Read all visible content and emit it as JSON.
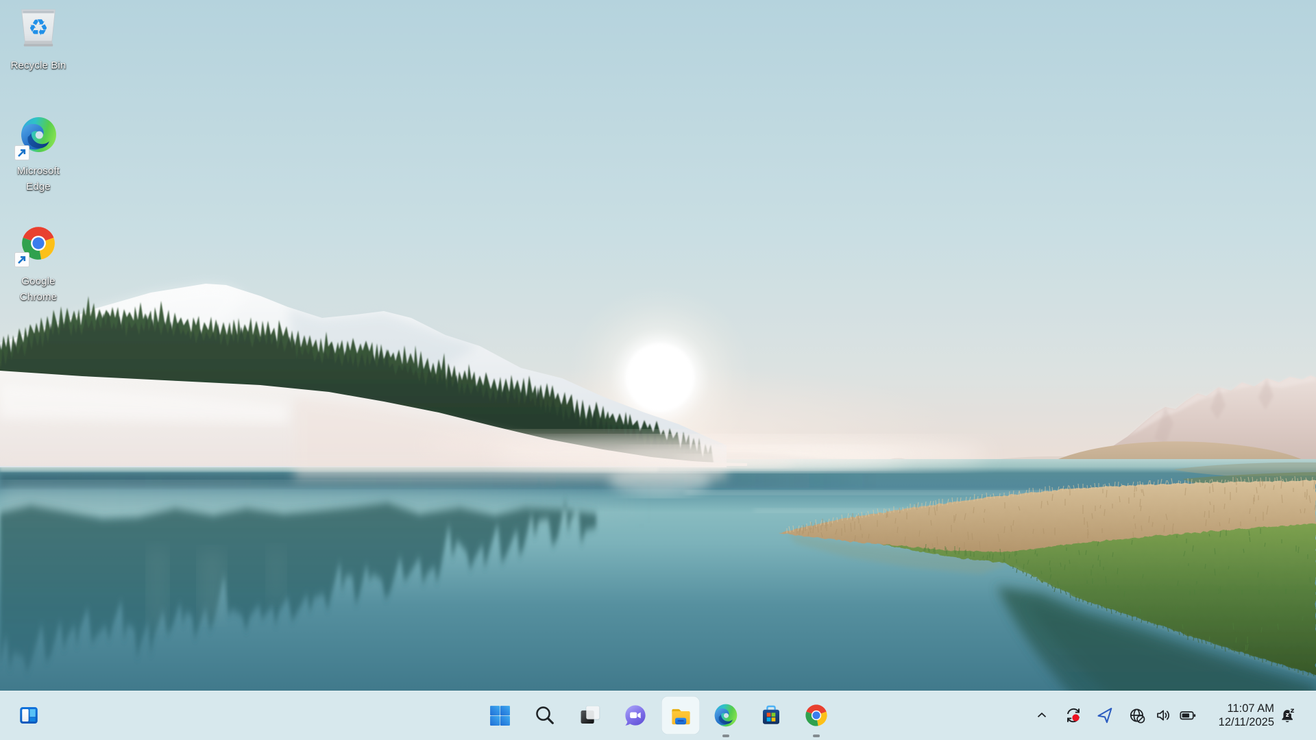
{
  "os": "windows-11-desktop",
  "wallpaper": {
    "scene": "sunrise over a calm turquoise lake with a snowy pine-covered hill on the left, pale mountains and grass banks on the right",
    "colors": {
      "sky_top": "#b5d3dd",
      "sky_horizon": "#ecdfd7",
      "sun": "#ffffff",
      "water_light": "#8ec3c6",
      "water_deep": "#3a7386",
      "snow": "#f2f4f4",
      "trees": "#2e4f38",
      "wheat_grass": "#d5c19c",
      "green_grass": "#6f9c49",
      "mountains": "#e3d7d3"
    }
  },
  "desktop": {
    "icons": [
      {
        "id": "recycle-bin",
        "label": "Recycle Bin",
        "icon": "recycle-bin-icon"
      },
      {
        "id": "microsoft-edge",
        "label": "Microsoft Edge",
        "icon": "edge-icon",
        "shortcut": true
      },
      {
        "id": "google-chrome",
        "label": "Google Chrome",
        "icon": "chrome-icon",
        "shortcut": true
      }
    ]
  },
  "taskbar": {
    "background": "#d7e8ed",
    "widgets_button": {
      "icon": "widgets-icon"
    },
    "center_items": [
      {
        "id": "start",
        "icon": "windows-start-icon"
      },
      {
        "id": "search",
        "icon": "search-icon"
      },
      {
        "id": "task-view",
        "icon": "task-view-icon"
      },
      {
        "id": "chat",
        "icon": "chat-icon"
      },
      {
        "id": "file-explorer",
        "icon": "file-explorer-icon",
        "state": "active"
      },
      {
        "id": "edge",
        "icon": "edge-icon",
        "state": "running"
      },
      {
        "id": "microsoft-store",
        "icon": "microsoft-store-icon"
      },
      {
        "id": "chrome",
        "icon": "chrome-icon",
        "state": "running"
      }
    ],
    "tray": {
      "show_hidden_icons": {
        "icon": "chevron-up-icon"
      },
      "icons": [
        {
          "id": "update-restart",
          "icon": "sync-alert-icon",
          "badge_color": "#e81224"
        },
        {
          "id": "location",
          "icon": "location-arrow-icon",
          "color": "#2b5cc0"
        },
        {
          "id": "network",
          "icon": "globe-no-internet-icon"
        },
        {
          "id": "volume",
          "icon": "speaker-icon"
        },
        {
          "id": "battery",
          "icon": "battery-icon"
        }
      ],
      "clock": {
        "time": "11:07 AM",
        "date": "12/11/2025"
      },
      "notification_bell": {
        "icon": "bell-dnd-icon"
      }
    }
  }
}
